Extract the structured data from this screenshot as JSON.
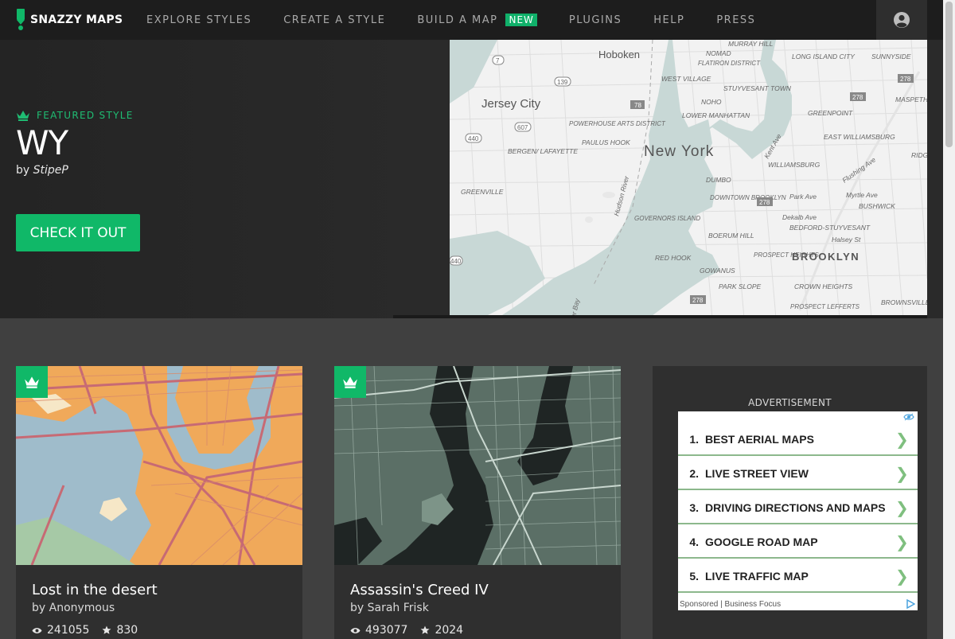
{
  "brand": {
    "name": "SNAZZY MAPS",
    "accent": "#10b868"
  },
  "nav": {
    "links": [
      "EXPLORE STYLES",
      "CREATE A STYLE",
      "BUILD A MAP",
      "PLUGINS",
      "HELP",
      "PRESS"
    ],
    "badge": "NEW",
    "account_icon": "user-circle-icon"
  },
  "hero": {
    "eyebrow": "FEATURED STYLE",
    "title": "WY",
    "by_prefix": "by",
    "author": "StipeP",
    "cta": "CHECK IT OUT",
    "map_labels": {
      "hoboken": "Hoboken",
      "jersey_city": "Jersey City",
      "new_york": "New York",
      "brooklyn": "BROOKLYN",
      "murray_hill": "MURRAY HILL",
      "nomad": "NOMAD",
      "flatiron": "FLATIRON DISTRICT",
      "west_village": "WEST VILLAGE",
      "stuyvesant": "STUYVESANT TOWN",
      "noho": "NOHO",
      "lower_manhattan": "LOWER MANHATTAN",
      "powerhouse": "POWERHOUSE ARTS DISTRICT",
      "paulus_hook": "PAULUS HOOK",
      "bergen": "BERGEN/ LAFAYETTE",
      "greenville": "GREENVILLE",
      "long_island_city": "LONG ISLAND CITY",
      "sunnyside": "SUNNYSIDE",
      "maspeth": "MASPETH",
      "greenpoint": "GREENPOINT",
      "east_williamsburg": "EAST WILLIAMSBURG",
      "williamsburg": "WILLIAMSBURG",
      "dumbo": "DUMBO",
      "downtown_brooklyn": "DOWNTOWN BROOKLYN",
      "governors_island": "GOVERNORS ISLAND",
      "boerum_hill": "BOERUM HILL",
      "bedford": "BEDFORD-STUYVESANT",
      "bushwick": "BUSHWICK",
      "red_hook": "RED HOOK",
      "gowanus": "GOWANUS",
      "prospect_heights": "PROSPECT HEIGHTS",
      "park_slope": "PARK SLOPE",
      "crown_heights": "CROWN HEIGHTS",
      "prospect_lefferts": "PROSPECT LEFFERTS",
      "brownsville": "BROWNSVILLE",
      "hudson_river": "Hudson River",
      "ridge": "RIDG",
      "park_ave": "Park Ave",
      "myrtle_ave": "Myrtle Ave",
      "dekalb_ave": "Dekalb Ave",
      "halsey_st": "Halsey St",
      "flushing_ave": "Flushing Ave",
      "kent_ave": "Kent Ave",
      "upper_bay": "er Bay",
      "route_7": "7",
      "route_139": "139",
      "route_78": "78",
      "route_607": "607",
      "route_440a": "440",
      "route_440b": "440",
      "route_278a": "278",
      "route_278b": "278",
      "route_278c": "278",
      "route_278d": "278"
    }
  },
  "cards": [
    {
      "title": "Lost in the desert",
      "by_prefix": "by",
      "author": "Anonymous",
      "views": "241055",
      "stars": "830"
    },
    {
      "title": "Assassin's Creed IV",
      "by_prefix": "by",
      "author": "Sarah Frisk",
      "views": "493077",
      "stars": "2024"
    }
  ],
  "ad": {
    "label": "ADVERTISEMENT",
    "items": [
      {
        "num": "1.",
        "text": "BEST AERIAL MAPS"
      },
      {
        "num": "2.",
        "text": "LIVE STREET VIEW"
      },
      {
        "num": "3.",
        "text": "DRIVING DIRECTIONS AND MAPS"
      },
      {
        "num": "4.",
        "text": "GOOGLE ROAD MAP"
      },
      {
        "num": "5.",
        "text": "LIVE TRAFFIC MAP"
      }
    ],
    "arrow": "❯",
    "footer": "Sponsored | Business Focus"
  }
}
